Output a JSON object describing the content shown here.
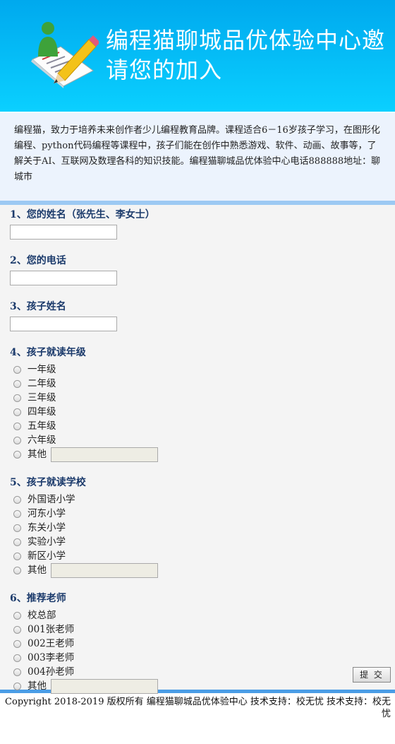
{
  "header": {
    "title": "编程猫聊城品优体验中心邀请您的加入"
  },
  "intro": {
    "text": "编程猫，致力于培养未来创作者少儿编程教育品牌。课程适合6－16岁孩子学习，在图形化编程、python代码编程等课程中，孩子们能在创作中熟悉游戏、软件、动画、故事等，了解关于AI、互联网及数理各科的知识技能。编程猫聊城品优体验中心电话888888地址：聊城市"
  },
  "questions": {
    "q1": "1、您的姓名（张先生、李女士）",
    "q2": "2、您的电话",
    "q3": "3、孩子姓名",
    "q4": "4、孩子就读年级",
    "q5": "5、孩子就读学校",
    "q6": "6、推荐老师"
  },
  "grades": [
    "一年级",
    "二年级",
    "三年级",
    "四年级",
    "五年级",
    "六年级",
    "其他"
  ],
  "schools": [
    "外国语小学",
    "河东小学",
    "东关小学",
    "实验小学",
    "新区小学",
    "其他"
  ],
  "teachers": [
    "校总部",
    "001张老师",
    "002王老师",
    "003李老师",
    "004孙老师",
    "其他"
  ],
  "submit_label": "提 交",
  "footer": {
    "text": "Copyright 2018-2019 版权所有 编程猫聊城品优体验中心 技术支持：校无忧 技术支持：校无忧"
  }
}
